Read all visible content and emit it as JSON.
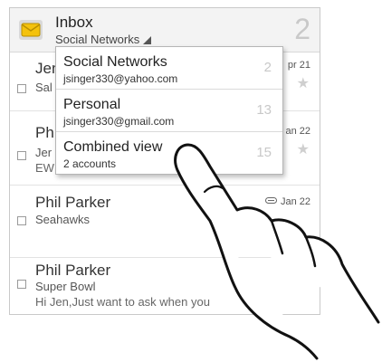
{
  "header": {
    "title": "Inbox",
    "subtitle": "Social Networks",
    "unread_count": "2"
  },
  "emails": [
    {
      "sender": "Jen",
      "subject": "Sal",
      "date": "pr 21"
    },
    {
      "sender": "Ph",
      "subject": "Jer",
      "preview": "EWI",
      "date": "an 22"
    },
    {
      "sender": "Phil Parker",
      "subject": "Seahawks",
      "date": "Jan 22"
    },
    {
      "sender": "Phil Parker",
      "subject": "Super Bowl",
      "preview": "Hi Jen,Just want to ask when you"
    }
  ],
  "account_menu": [
    {
      "title": "Social Networks",
      "subtitle": "jsinger330@yahoo.com",
      "count": "2"
    },
    {
      "title": "Personal",
      "subtitle": "jsinger330@gmail.com",
      "count": "13"
    },
    {
      "title": "Combined view",
      "subtitle": "2 accounts",
      "count": "15"
    }
  ],
  "icons": {
    "mail": "envelope-icon",
    "star": "star-icon",
    "attachment": "paperclip-icon",
    "dropdown": "dropdown-triangle-icon",
    "hand": "pointing-hand-illustration"
  },
  "colors": {
    "envelope": "#f4c20d",
    "header_bg": "#f3f3f3",
    "count_gray": "#c9c9c9"
  }
}
